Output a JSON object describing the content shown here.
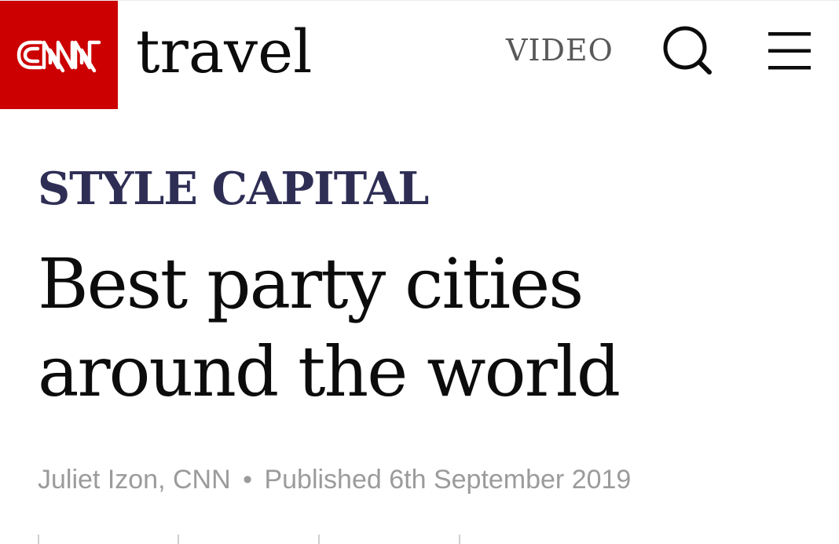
{
  "header": {
    "logo_text": "CNN",
    "section": "travel",
    "nav": {
      "video_label": "VIDEO",
      "search_icon": "search-icon",
      "menu_icon": "hamburger-menu-icon"
    },
    "brand_color": "#cc0000"
  },
  "article": {
    "kicker": "STYLE CAPITAL",
    "kicker_color": "#2e2e55",
    "headline": "Best party cities around the world",
    "byline": {
      "author": "Juliet Izon, CNN",
      "separator": "•",
      "published": "Published 6th September 2019"
    }
  }
}
